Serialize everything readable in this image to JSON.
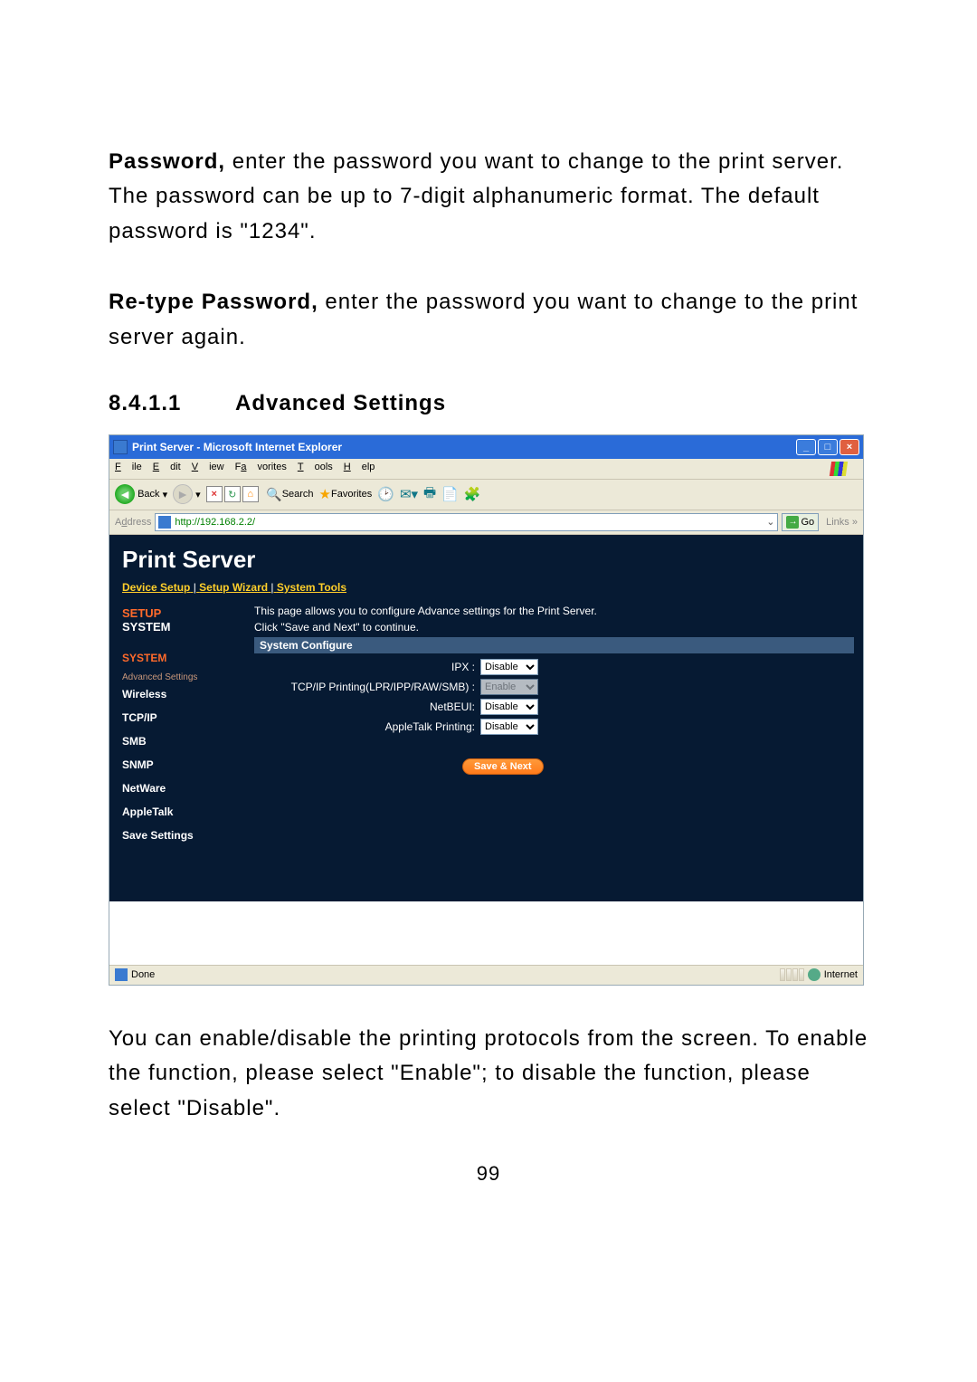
{
  "para1": {
    "bold": "Password,",
    "rest": " enter the password you want to change to the print server. The password can be up to 7-digit alphanumeric format. The default password is \"1234\"."
  },
  "para2": {
    "bold": "Re-type Password,",
    "rest": " enter the password you want to change to the print server again."
  },
  "section": {
    "num": "8.4.1.1",
    "title": "Advanced Settings"
  },
  "browser": {
    "title": "Print Server - Microsoft Internet Explorer",
    "menu": {
      "file": "File",
      "edit": "Edit",
      "view": "View",
      "favorites": "Favorites",
      "tools": "Tools",
      "help": "Help"
    },
    "toolbar": {
      "back": "Back",
      "search": "Search",
      "favorites": "Favorites"
    },
    "address_label": "Address",
    "address": "http://192.168.2.2/",
    "go": "Go",
    "links": "Links",
    "status_done": "Done",
    "status_zone": "Internet"
  },
  "page": {
    "app_title": "Print Server",
    "top_links": {
      "device": "Device Setup",
      "wizard": "Setup Wizard",
      "tools": "System Tools",
      "sep": " | "
    },
    "setup": {
      "red": "SETUP",
      "wh": "SYSTEM"
    },
    "side_system": "SYSTEM",
    "side_adv": "Advanced Settings",
    "nav": {
      "wireless": "Wireless",
      "tcpip": "TCP/IP",
      "smb": "SMB",
      "snmp": "SNMP",
      "netware": "NetWare",
      "appletalk": "AppleTalk",
      "save": "Save Settings"
    },
    "desc": "This page allows you to configure Advance settings for the Print Server.",
    "sub": "Click \"Save and Next\" to continue.",
    "sysconf": "System Configure",
    "rows": {
      "ipx": {
        "label": "IPX :",
        "value": "Disable"
      },
      "tcp": {
        "label": "TCP/IP Printing(LPR/IPP/RAW/SMB) :",
        "value": "Enable"
      },
      "netbeui": {
        "label": "NetBEUI:",
        "value": "Disable"
      },
      "appletalk": {
        "label": "AppleTalk Printing:",
        "value": "Disable"
      }
    },
    "save_btn": "Save & Next"
  },
  "para3": "You can enable/disable the printing protocols from the screen. To enable the function, please select \"Enable\"; to disable the function, please select \"Disable\".",
  "page_num": "99"
}
